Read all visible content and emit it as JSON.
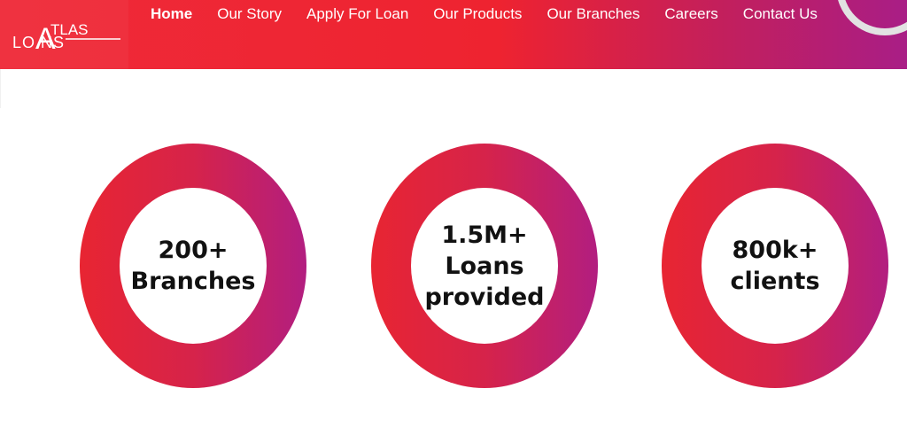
{
  "logo": {
    "text_top": "TLAS",
    "text_bottom": "LO NS",
    "letter": "A"
  },
  "nav": {
    "items": [
      {
        "label": "Home"
      },
      {
        "label": "Our Story"
      },
      {
        "label": "Apply For Loan"
      },
      {
        "label": "Our Products"
      },
      {
        "label": "Our Branches"
      },
      {
        "label": "Careers"
      },
      {
        "label": "Contact Us"
      }
    ]
  },
  "stats": [
    {
      "text": "200+\nBranches"
    },
    {
      "text": "1.5M+\nLoans\nprovided"
    },
    {
      "text": "800k+\nclients"
    }
  ],
  "colors": {
    "brand_red": "#ee2330",
    "brand_purple": "#a91e86"
  }
}
